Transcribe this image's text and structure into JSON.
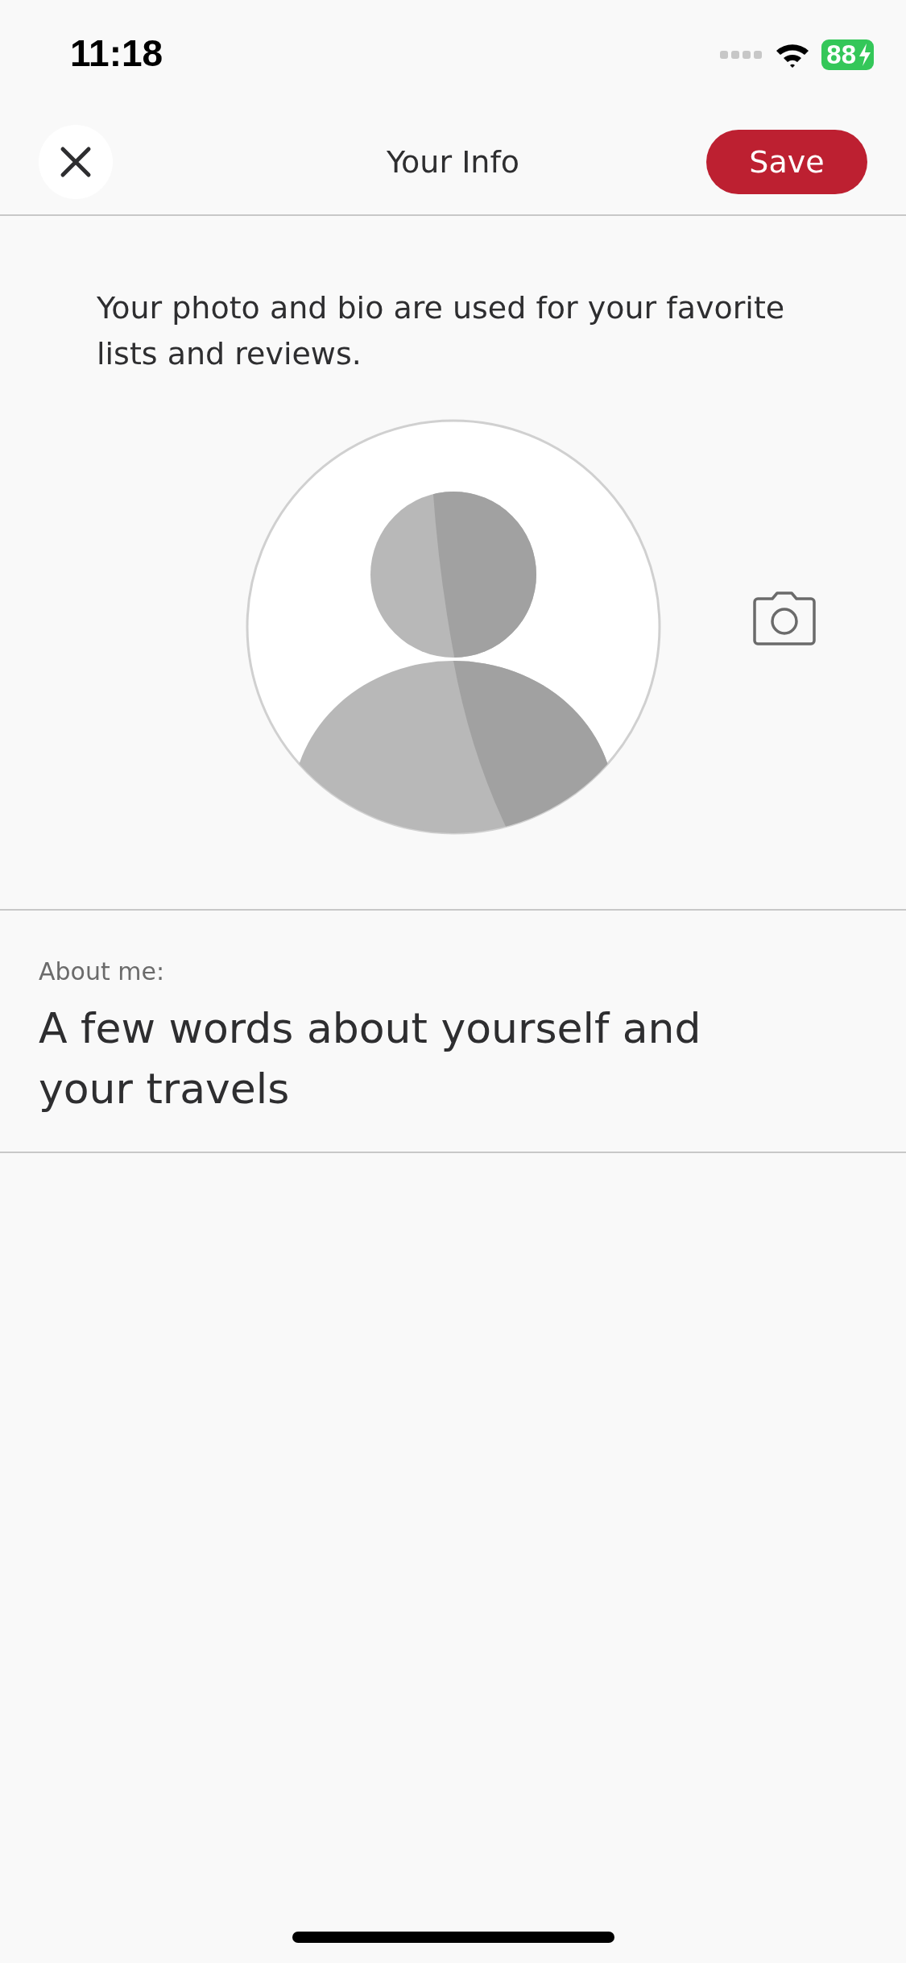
{
  "status_bar": {
    "time": "11:18",
    "battery": "88"
  },
  "header": {
    "title": "Your Info",
    "save_button": "Save"
  },
  "intro": "Your photo and bio are used for your favorite lists and reviews.",
  "about": {
    "label": "About me:",
    "placeholder": "A few words about yourself and your travels"
  }
}
